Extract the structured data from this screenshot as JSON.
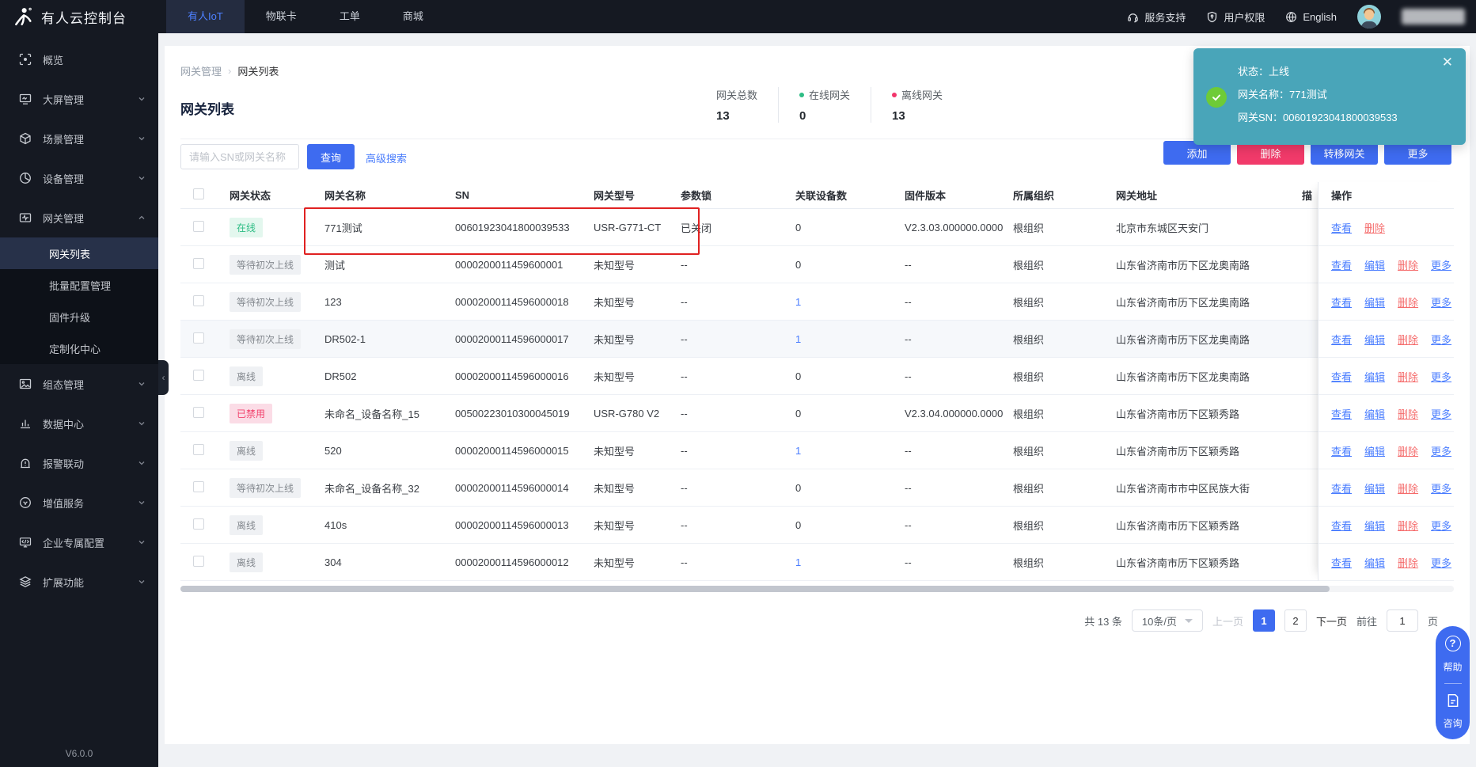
{
  "header": {
    "logo_title": "有人云控制台",
    "nav": [
      {
        "label": "有人IoT"
      },
      {
        "label": "物联卡"
      },
      {
        "label": "工单"
      },
      {
        "label": "商城"
      }
    ],
    "right": [
      {
        "label": "服务支持"
      },
      {
        "label": "用户权限"
      },
      {
        "label": "English"
      }
    ]
  },
  "sidebar": {
    "version": "V6.0.0",
    "items": [
      {
        "label": "概览"
      },
      {
        "label": "大屏管理"
      },
      {
        "label": "场景管理"
      },
      {
        "label": "设备管理"
      },
      {
        "label": "网关管理",
        "children": [
          {
            "label": "网关列表"
          },
          {
            "label": "批量配置管理"
          },
          {
            "label": "固件升级"
          },
          {
            "label": "定制化中心"
          }
        ]
      },
      {
        "label": "组态管理"
      },
      {
        "label": "数据中心"
      },
      {
        "label": "报警联动"
      },
      {
        "label": "增值服务"
      },
      {
        "label": "企业专属配置"
      },
      {
        "label": "扩展功能"
      }
    ]
  },
  "breadcrumb": {
    "parent": "网关管理",
    "sep": "›",
    "current": "网关列表"
  },
  "page": {
    "title": "网关列表"
  },
  "stats": {
    "total_label": "网关总数",
    "total_value": "13",
    "online_label": "在线网关",
    "online_value": "0",
    "offline_label": "离线网关",
    "offline_value": "13",
    "online_color": "#2ebd85",
    "offline_color": "#f2356b"
  },
  "toolbar": {
    "search_placeholder": "请输入SN或网关名称",
    "search_button": "查询",
    "advanced_search": "高级搜索",
    "add": "添加",
    "delete": "删除",
    "transfer": "转移网关",
    "more": "更多"
  },
  "toast": {
    "line1": "状态：上线",
    "line2": "网关名称：771测试",
    "line3": "网关SN：00601923041800039533"
  },
  "icons": {
    "collapse_glyph": "‹",
    "close_glyph": "✕",
    "help_glyph": "?",
    "check_glyph": "✓"
  },
  "table": {
    "headers": [
      "网关状态",
      "网关名称",
      "SN",
      "网关型号",
      "参数锁",
      "关联设备数",
      "固件版本",
      "所属组织",
      "网关地址"
    ],
    "clipped_header": "描",
    "op_header": "操作",
    "rows": [
      {
        "status": "在线",
        "status_class": "online",
        "name": "771测试",
        "sn": "00601923041800039533",
        "model": "USR-G771-CT",
        "lock": "已关闭",
        "devices": "0",
        "devices_link": false,
        "firmware": "V2.3.03.000000.0000",
        "org": "根组织",
        "address": "北京市东城区天安门",
        "marked": true,
        "shaded": false,
        "ops": [
          {
            "label": "查看",
            "cls": "view"
          },
          {
            "label": "删除",
            "cls": "delete"
          }
        ]
      },
      {
        "status": "等待初次上线",
        "status_class": "waiting",
        "name": "测试",
        "sn": "0000200011459600001",
        "model": "未知型号",
        "lock": "--",
        "devices": "0",
        "devices_link": false,
        "firmware": "--",
        "org": "根组织",
        "address": "山东省济南市历下区龙奥南路",
        "marked": false,
        "shaded": false,
        "ops": [
          {
            "label": "查看",
            "cls": "view"
          },
          {
            "label": "编辑",
            "cls": "edit"
          },
          {
            "label": "删除",
            "cls": "delete"
          },
          {
            "label": "更多",
            "cls": "more"
          }
        ]
      },
      {
        "status": "等待初次上线",
        "status_class": "waiting",
        "name": "123",
        "sn": "00002000114596000018",
        "model": "未知型号",
        "lock": "--",
        "devices": "1",
        "devices_link": true,
        "firmware": "--",
        "org": "根组织",
        "address": "山东省济南市历下区龙奥南路",
        "marked": false,
        "shaded": false,
        "ops": [
          {
            "label": "查看",
            "cls": "view"
          },
          {
            "label": "编辑",
            "cls": "edit"
          },
          {
            "label": "删除",
            "cls": "delete"
          },
          {
            "label": "更多",
            "cls": "more"
          }
        ]
      },
      {
        "status": "等待初次上线",
        "status_class": "waiting",
        "name": "DR502-1",
        "sn": "00002000114596000017",
        "model": "未知型号",
        "lock": "--",
        "devices": "1",
        "devices_link": true,
        "firmware": "--",
        "org": "根组织",
        "address": "山东省济南市历下区龙奥南路",
        "marked": false,
        "shaded": true,
        "ops": [
          {
            "label": "查看",
            "cls": "view"
          },
          {
            "label": "编辑",
            "cls": "edit"
          },
          {
            "label": "删除",
            "cls": "delete"
          },
          {
            "label": "更多",
            "cls": "more"
          }
        ]
      },
      {
        "status": "离线",
        "status_class": "offline",
        "name": "DR502",
        "sn": "00002000114596000016",
        "model": "未知型号",
        "lock": "--",
        "devices": "0",
        "devices_link": false,
        "firmware": "--",
        "org": "根组织",
        "address": "山东省济南市历下区龙奥南路",
        "marked": false,
        "shaded": false,
        "ops": [
          {
            "label": "查看",
            "cls": "view"
          },
          {
            "label": "编辑",
            "cls": "edit"
          },
          {
            "label": "删除",
            "cls": "delete"
          },
          {
            "label": "更多",
            "cls": "more"
          }
        ]
      },
      {
        "status": "已禁用",
        "status_class": "disabled",
        "name": "未命名_设备名称_15",
        "sn": "00500223010300045019",
        "model": "USR-G780 V2",
        "lock": "--",
        "devices": "0",
        "devices_link": false,
        "firmware": "V2.3.04.000000.0000",
        "org": "根组织",
        "address": "山东省济南市历下区颖秀路",
        "marked": false,
        "shaded": false,
        "ops": [
          {
            "label": "查看",
            "cls": "view"
          },
          {
            "label": "编辑",
            "cls": "edit"
          },
          {
            "label": "删除",
            "cls": "delete"
          },
          {
            "label": "更多",
            "cls": "more"
          }
        ]
      },
      {
        "status": "离线",
        "status_class": "offline",
        "name": "520",
        "sn": "00002000114596000015",
        "model": "未知型号",
        "lock": "--",
        "devices": "1",
        "devices_link": true,
        "firmware": "--",
        "org": "根组织",
        "address": "山东省济南市历下区颖秀路",
        "marked": false,
        "shaded": false,
        "ops": [
          {
            "label": "查看",
            "cls": "view"
          },
          {
            "label": "编辑",
            "cls": "edit"
          },
          {
            "label": "删除",
            "cls": "delete"
          },
          {
            "label": "更多",
            "cls": "more"
          }
        ]
      },
      {
        "status": "等待初次上线",
        "status_class": "waiting",
        "name": "未命名_设备名称_32",
        "sn": "00002000114596000014",
        "model": "未知型号",
        "lock": "--",
        "devices": "0",
        "devices_link": false,
        "firmware": "--",
        "org": "根组织",
        "address": "山东省济南市市中区民族大街",
        "marked": false,
        "shaded": false,
        "ops": [
          {
            "label": "查看",
            "cls": "view"
          },
          {
            "label": "编辑",
            "cls": "edit"
          },
          {
            "label": "删除",
            "cls": "delete"
          },
          {
            "label": "更多",
            "cls": "more"
          }
        ]
      },
      {
        "status": "离线",
        "status_class": "offline",
        "name": "410s",
        "sn": "00002000114596000013",
        "model": "未知型号",
        "lock": "--",
        "devices": "0",
        "devices_link": false,
        "firmware": "--",
        "org": "根组织",
        "address": "山东省济南市历下区颖秀路",
        "marked": false,
        "shaded": false,
        "ops": [
          {
            "label": "查看",
            "cls": "view"
          },
          {
            "label": "编辑",
            "cls": "edit"
          },
          {
            "label": "删除",
            "cls": "delete"
          },
          {
            "label": "更多",
            "cls": "more"
          }
        ]
      },
      {
        "status": "离线",
        "status_class": "offline",
        "name": "304",
        "sn": "00002000114596000012",
        "model": "未知型号",
        "lock": "--",
        "devices": "1",
        "devices_link": true,
        "firmware": "--",
        "org": "根组织",
        "address": "山东省济南市历下区颖秀路",
        "marked": false,
        "shaded": false,
        "ops": [
          {
            "label": "查看",
            "cls": "view"
          },
          {
            "label": "编辑",
            "cls": "edit"
          },
          {
            "label": "删除",
            "cls": "delete"
          },
          {
            "label": "更多",
            "cls": "more"
          }
        ]
      }
    ]
  },
  "pagination": {
    "total": "共 13 条",
    "page_size": "10条/页",
    "prev": "上一页",
    "pages": [
      "1",
      "2"
    ],
    "next": "下一页",
    "goto_label": "前往",
    "goto_value": "1",
    "goto_unit": "页"
  },
  "float_menu": {
    "help": "帮助",
    "consult": "咨询"
  }
}
